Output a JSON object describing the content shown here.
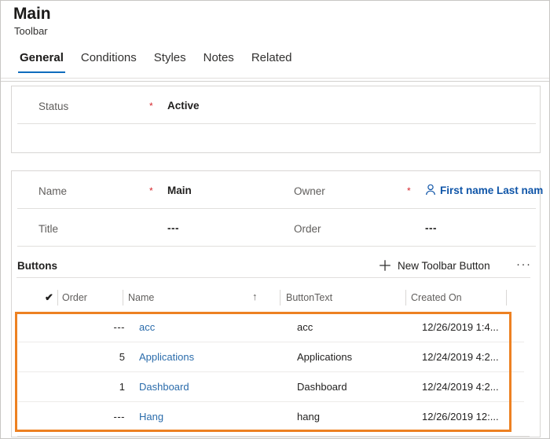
{
  "header": {
    "title": "Main",
    "subtitle": "Toolbar",
    "tabs": [
      {
        "label": "General",
        "active": true
      },
      {
        "label": "Conditions",
        "active": false
      },
      {
        "label": "Styles",
        "active": false
      },
      {
        "label": "Notes",
        "active": false
      },
      {
        "label": "Related",
        "active": false
      }
    ]
  },
  "status_card": {
    "label": "Status",
    "required_marker": "*",
    "value": "Active"
  },
  "main_card": {
    "rows": [
      {
        "left_label": "Name",
        "left_required": "*",
        "left_value": "Main",
        "right_label": "Owner",
        "right_required": "*",
        "right_value": "First name Last nam",
        "right_is_link": true,
        "right_icon": "person-icon"
      },
      {
        "left_label": "Title",
        "left_required": "",
        "left_value": "---",
        "right_label": "Order",
        "right_required": "",
        "right_value": "---",
        "right_is_link": false,
        "right_icon": ""
      }
    ]
  },
  "subgrid": {
    "title": "Buttons",
    "new_button_label": "New Toolbar Button",
    "plus_icon": "plus-icon",
    "overflow_icon": "ellipsis-icon",
    "overflow_label": "···",
    "select_all_icon": "checkmark-icon",
    "select_all_glyph": "✔",
    "sort_icon": "sort-ascending-icon",
    "sort_glyph": "↑",
    "columns": [
      {
        "label": "Order"
      },
      {
        "label": "Name"
      },
      {
        "label": "ButtonText"
      },
      {
        "label": "Created On"
      }
    ],
    "rows": [
      {
        "order": "---",
        "name": "acc",
        "button_text": "acc",
        "created_on": "12/26/2019 1:4..."
      },
      {
        "order": "5",
        "name": "Applications",
        "button_text": "Applications",
        "created_on": "12/24/2019 4:2..."
      },
      {
        "order": "1",
        "name": "Dashboard",
        "button_text": "Dashboard",
        "created_on": "12/24/2019 4:2..."
      },
      {
        "order": "---",
        "name": "Hang",
        "button_text": "hang",
        "created_on": "12/26/2019 12:..."
      }
    ]
  },
  "colors": {
    "accent_blue": "#0f6cbd",
    "link_blue": "#2b6cab",
    "owner_link_blue": "#0f55a8",
    "required_red": "#d6262c",
    "highlight_orange": "#ed8122",
    "text_primary": "#201f1e",
    "text_secondary": "#605e5c",
    "border_gray": "#d8d6d4"
  }
}
